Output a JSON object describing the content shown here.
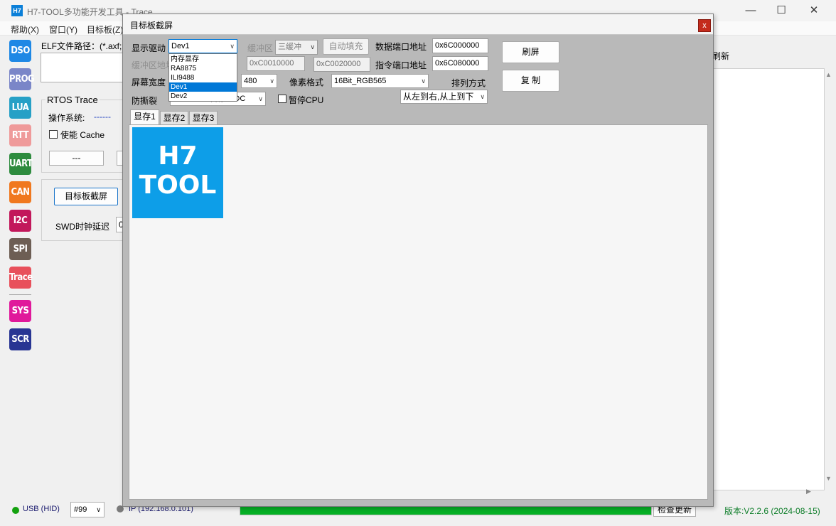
{
  "app": {
    "icon_text": "H7",
    "title": "H7-TOOL多功能开发工具 - Trace",
    "controls": {
      "minimize": "—",
      "maximize": "☐",
      "close": "✕"
    }
  },
  "menu": [
    "帮助(X)",
    "窗口(Y)",
    "目标板(Z)"
  ],
  "toolbar": [
    {
      "label": "DSO",
      "color": "#1e88e5"
    },
    {
      "label": "PROG",
      "color": "#7a86c8"
    },
    {
      "label": "LUA",
      "color": "#26a0c6"
    },
    {
      "label": "RTT",
      "color": "#ef9a9a"
    },
    {
      "label": "UART",
      "color": "#2e8b3e"
    },
    {
      "label": "CAN",
      "color": "#f0781e"
    },
    {
      "label": "I2C",
      "color": "#c2185b"
    },
    {
      "label": "SPI",
      "color": "#6d5e54"
    },
    {
      "label": "Trace",
      "color": "#e8505b"
    },
    {
      "label": "SYS",
      "color": "#e0199b"
    },
    {
      "label": "SCR",
      "color": "#283593"
    }
  ],
  "left_panel": {
    "elf_label": "ELF文件路径：(*.axf;",
    "rtos_group": "RTOS Trace",
    "os_label": "操作系统:",
    "os_value": "------",
    "cache_label": "使能 Cache",
    "dash_button": "---",
    "capture_button": "目标板截屏",
    "swd_label": "SWD时钟延迟",
    "swd_value": "0"
  },
  "right_panel": {
    "refresh_text": "刷新"
  },
  "status": {
    "usb": "USB (HID)",
    "usb_color": "#13a10e",
    "device": "#99",
    "ip": "IP (192.168.0.101)",
    "progress": 1.0,
    "progress_color": "#06b025",
    "update_button": "检查更新",
    "version": "版本:V2.2.6 (2024-08-15)",
    "version_color": "#0c7d28"
  },
  "dialog": {
    "title": "目标板截屏",
    "close": "x",
    "display_driver_label": "显示驱动",
    "display_driver_value": "Dev1",
    "buffer_label": "缓冲区",
    "buffer_value": "三缓冲",
    "auto_fill_button": "自动填充",
    "data_port_label": "数据端口地址",
    "data_port_value": "0x6C000000",
    "refresh_button": "刷屏",
    "buffer_addr_label": "缓冲区地址",
    "buffer_addr1": "0xC0010000",
    "buffer_addr2": "0xC0020000",
    "cmd_port_label": "指令端口地址",
    "cmd_port_value": "0x6C080000",
    "copy_button": "复 制",
    "screen_width_label": "屏幕宽度",
    "screen_height_value": "480",
    "pixel_format_label": "像素格式",
    "pixel_format_value": "16Bit_RGB565",
    "order_label": "排列方式",
    "order_value": "从左到右,从上到下",
    "anti_tear_label": "防撕裂",
    "anti_tear_value": "DSI/LTDC 暂停LTDC",
    "pause_cpu_label": "暂停CPU",
    "tabs": [
      "显存1",
      "显存2",
      "显存3"
    ],
    "logo_line1": "H7",
    "logo_line2": "TOOL",
    "driver_options": [
      "内存显存",
      "RA8875",
      "ILI9488",
      "Dev1",
      "Dev2"
    ],
    "selected_option": "Dev1"
  }
}
